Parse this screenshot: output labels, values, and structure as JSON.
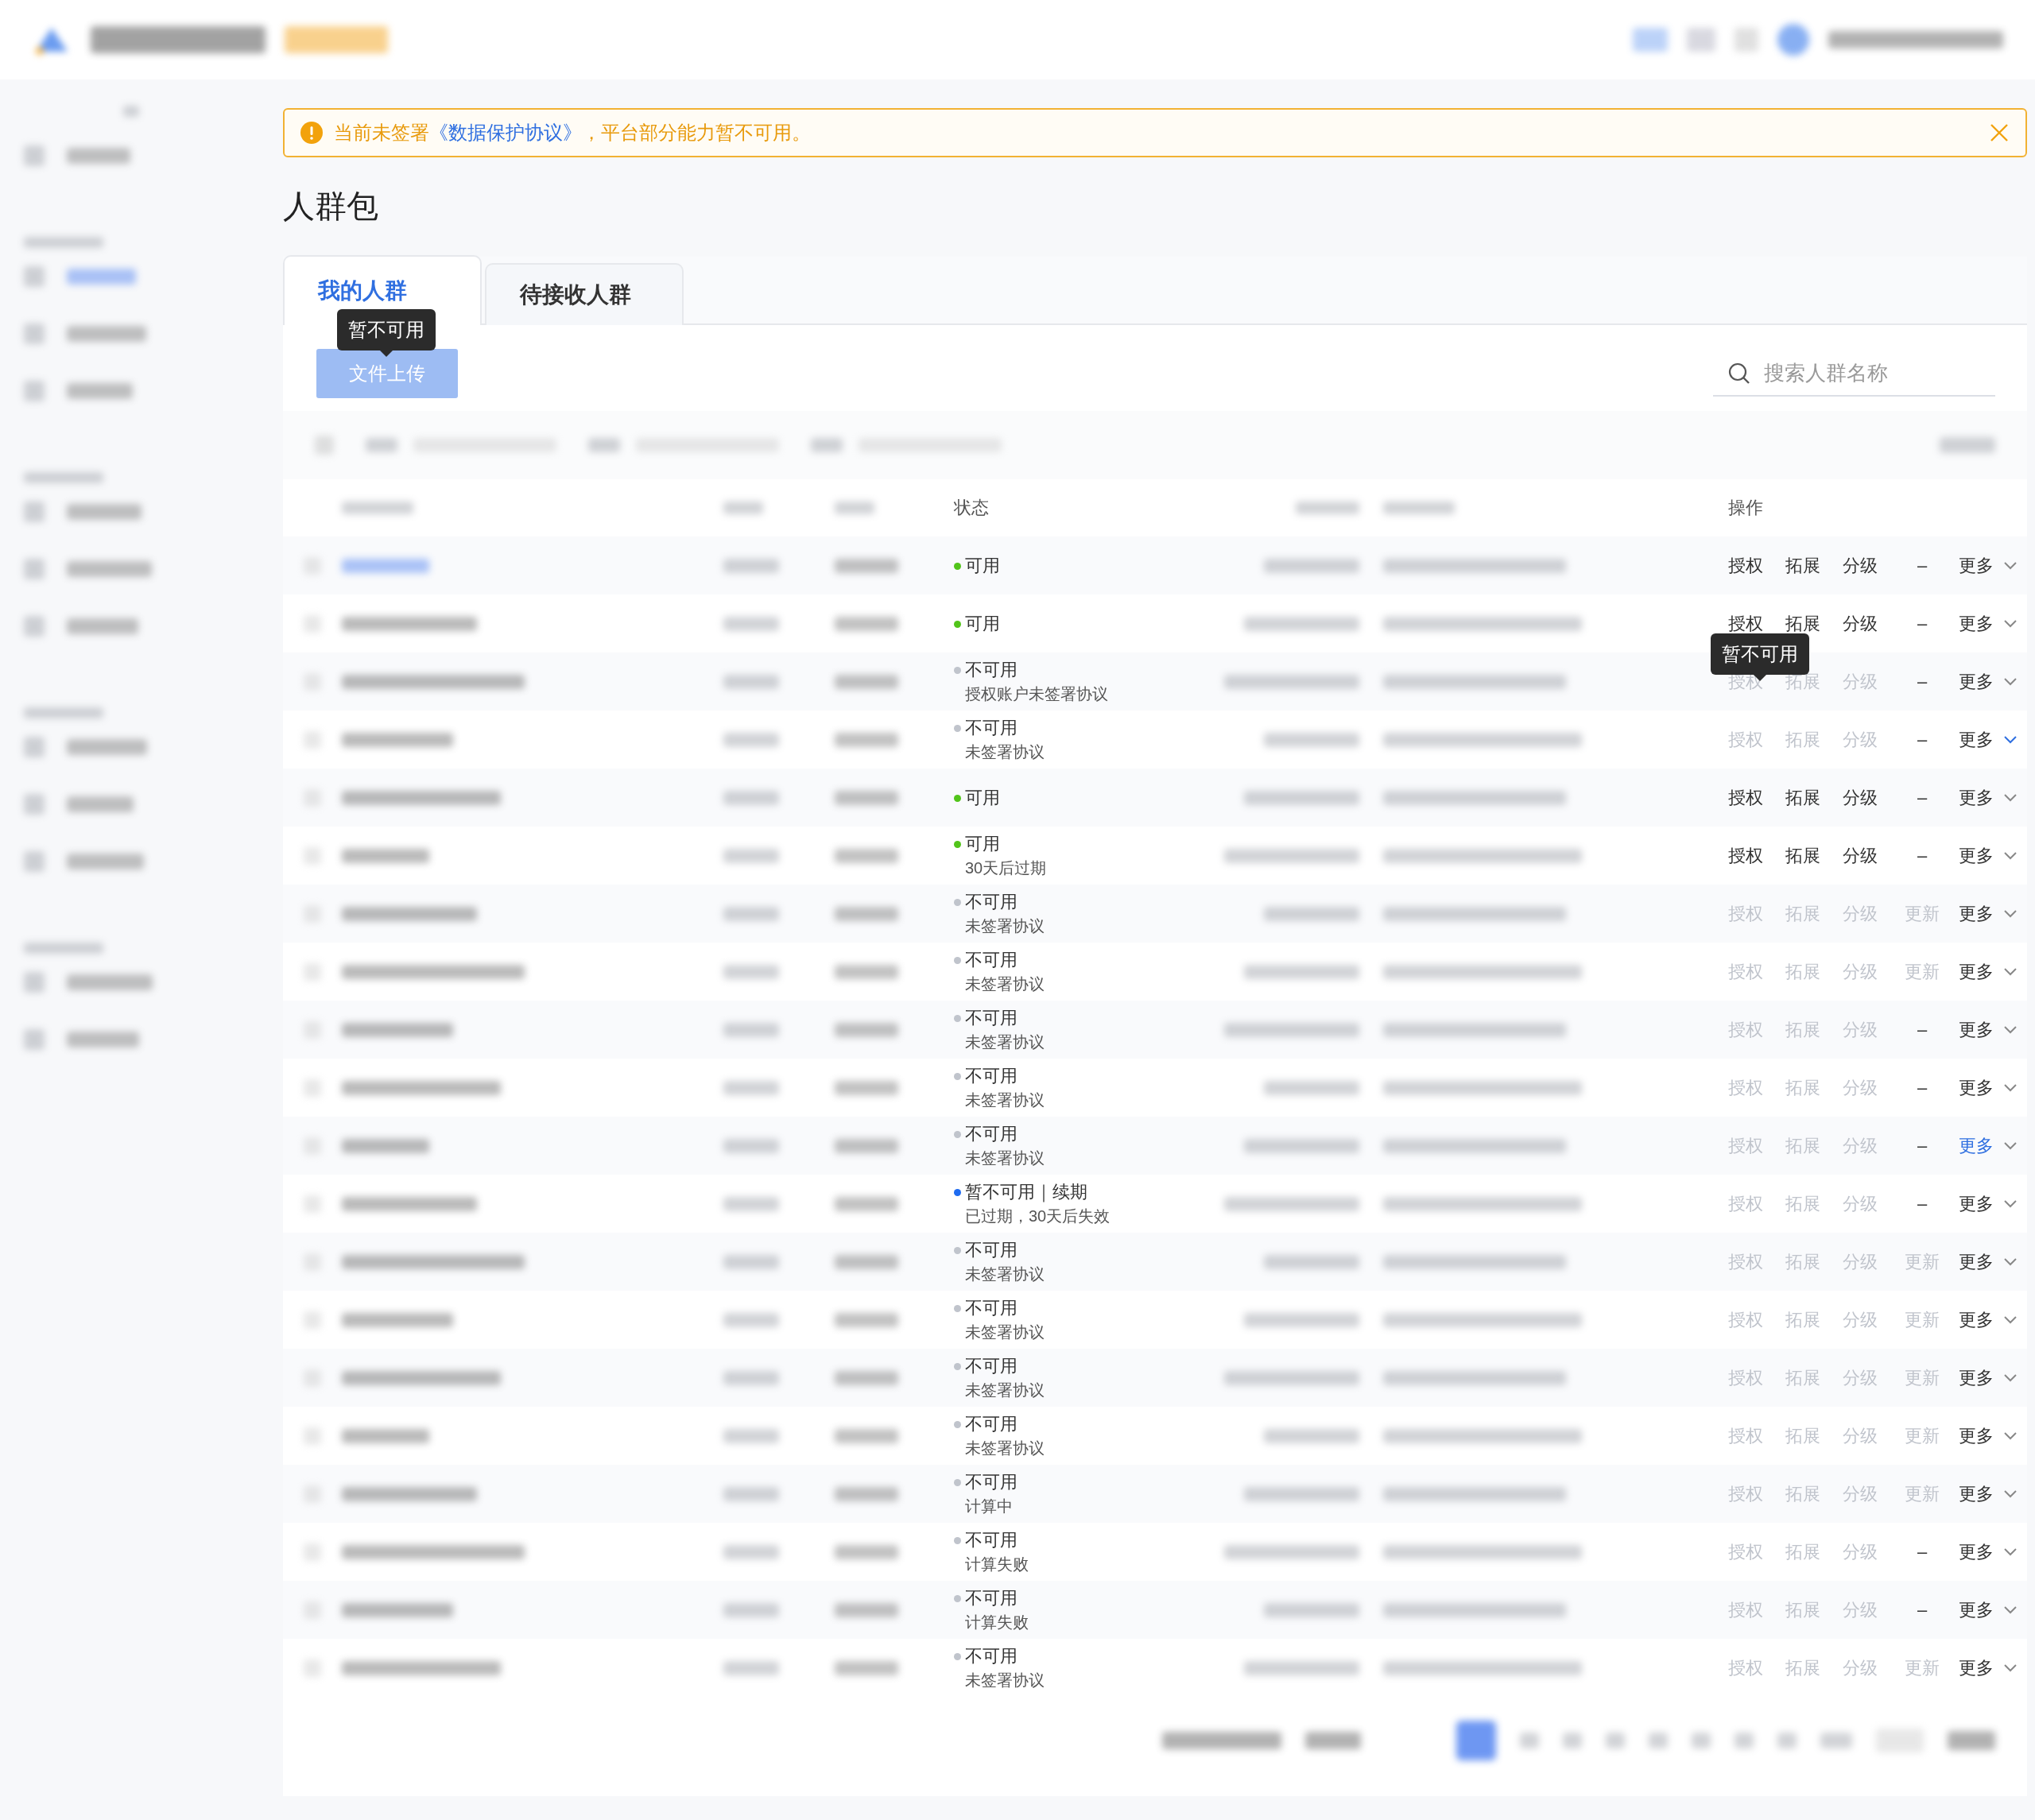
{
  "alert": {
    "text_before": "当前未签署",
    "link": "《数据保护协议》",
    "text_after": "，平台部分能力暂不可用。"
  },
  "page_title": "人群包",
  "tabs": [
    {
      "label": "我的人群",
      "selected": true
    },
    {
      "label": "待接收人群",
      "selected": false
    }
  ],
  "upload_button": {
    "label": "文件上传",
    "disabled": true,
    "tooltip": "暂不可用"
  },
  "search": {
    "placeholder": "搜索人群名称"
  },
  "table": {
    "columns": {
      "status": "状态",
      "actions": "操作"
    },
    "rows": [
      {
        "status": {
          "label": "可用",
          "color": "#52c41a"
        },
        "actions": [
          {
            "label": "授权",
            "disabled": false
          },
          {
            "label": "拓展",
            "disabled": false
          },
          {
            "label": "分级",
            "disabled": false
          },
          {
            "label": "–",
            "disabled": false
          }
        ],
        "more": {
          "label": "更多",
          "highlighted": false,
          "arrow_highlighted": false
        }
      },
      {
        "status": {
          "label": "可用",
          "color": "#52c41a"
        },
        "actions": [
          {
            "label": "授权",
            "disabled": false
          },
          {
            "label": "拓展",
            "disabled": false
          },
          {
            "label": "分级",
            "disabled": false
          },
          {
            "label": "–",
            "disabled": false
          }
        ],
        "more": {
          "label": "更多",
          "highlighted": false,
          "arrow_highlighted": false
        }
      },
      {
        "status": {
          "label": "不可用",
          "sub": "授权账户未签署协议",
          "color": "#c0c4cc"
        },
        "actions": [
          {
            "label": "授权",
            "disabled": true,
            "tooltip": "暂不可用"
          },
          {
            "label": "拓展",
            "disabled": true
          },
          {
            "label": "分级",
            "disabled": true
          },
          {
            "label": "–",
            "disabled": false
          }
        ],
        "more": {
          "label": "更多",
          "highlighted": false,
          "arrow_highlighted": false
        }
      },
      {
        "status": {
          "label": "不可用",
          "sub": "未签署协议",
          "color": "#c0c4cc"
        },
        "actions": [
          {
            "label": "授权",
            "disabled": true
          },
          {
            "label": "拓展",
            "disabled": true
          },
          {
            "label": "分级",
            "disabled": true
          },
          {
            "label": "–",
            "disabled": false
          }
        ],
        "more": {
          "label": "更多",
          "highlighted": false,
          "arrow_highlighted": true
        }
      },
      {
        "status": {
          "label": "可用",
          "color": "#52c41a"
        },
        "actions": [
          {
            "label": "授权",
            "disabled": false
          },
          {
            "label": "拓展",
            "disabled": false
          },
          {
            "label": "分级",
            "disabled": false
          },
          {
            "label": "–",
            "disabled": false
          }
        ],
        "more": {
          "label": "更多",
          "highlighted": false,
          "arrow_highlighted": false
        }
      },
      {
        "status": {
          "label": "可用",
          "sub": "30天后过期",
          "color": "#52c41a"
        },
        "actions": [
          {
            "label": "授权",
            "disabled": false
          },
          {
            "label": "拓展",
            "disabled": false
          },
          {
            "label": "分级",
            "disabled": false
          },
          {
            "label": "–",
            "disabled": false
          }
        ],
        "more": {
          "label": "更多",
          "highlighted": false,
          "arrow_highlighted": false
        }
      },
      {
        "status": {
          "label": "不可用",
          "sub": "未签署协议",
          "color": "#c0c4cc"
        },
        "actions": [
          {
            "label": "授权",
            "disabled": true
          },
          {
            "label": "拓展",
            "disabled": true
          },
          {
            "label": "分级",
            "disabled": true
          },
          {
            "label": "更新",
            "disabled": true
          }
        ],
        "more": {
          "label": "更多",
          "highlighted": false,
          "arrow_highlighted": false
        }
      },
      {
        "status": {
          "label": "不可用",
          "sub": "未签署协议",
          "color": "#c0c4cc"
        },
        "actions": [
          {
            "label": "授权",
            "disabled": true
          },
          {
            "label": "拓展",
            "disabled": true
          },
          {
            "label": "分级",
            "disabled": true
          },
          {
            "label": "更新",
            "disabled": true
          }
        ],
        "more": {
          "label": "更多",
          "highlighted": false,
          "arrow_highlighted": false
        }
      },
      {
        "status": {
          "label": "不可用",
          "sub": "未签署协议",
          "color": "#c0c4cc"
        },
        "actions": [
          {
            "label": "授权",
            "disabled": true
          },
          {
            "label": "拓展",
            "disabled": true
          },
          {
            "label": "分级",
            "disabled": true
          },
          {
            "label": "–",
            "disabled": false
          }
        ],
        "more": {
          "label": "更多",
          "highlighted": false,
          "arrow_highlighted": false
        }
      },
      {
        "status": {
          "label": "不可用",
          "sub": "未签署协议",
          "color": "#c0c4cc"
        },
        "actions": [
          {
            "label": "授权",
            "disabled": true
          },
          {
            "label": "拓展",
            "disabled": true
          },
          {
            "label": "分级",
            "disabled": true
          },
          {
            "label": "–",
            "disabled": false
          }
        ],
        "more": {
          "label": "更多",
          "highlighted": false,
          "arrow_highlighted": false
        }
      },
      {
        "status": {
          "label": "不可用",
          "sub": "未签署协议",
          "color": "#c0c4cc"
        },
        "actions": [
          {
            "label": "授权",
            "disabled": true
          },
          {
            "label": "拓展",
            "disabled": true
          },
          {
            "label": "分级",
            "disabled": true
          },
          {
            "label": "–",
            "disabled": false
          }
        ],
        "more": {
          "label": "更多",
          "highlighted": true,
          "arrow_highlighted": false
        }
      },
      {
        "status": {
          "label": "暂不可用｜续期",
          "sub": "已过期，30天后失效",
          "color": "#1f6bf0"
        },
        "actions": [
          {
            "label": "授权",
            "disabled": true
          },
          {
            "label": "拓展",
            "disabled": true
          },
          {
            "label": "分级",
            "disabled": true
          },
          {
            "label": "–",
            "disabled": false
          }
        ],
        "more": {
          "label": "更多",
          "highlighted": false,
          "arrow_highlighted": false
        }
      },
      {
        "status": {
          "label": "不可用",
          "sub": "未签署协议",
          "color": "#c0c4cc"
        },
        "actions": [
          {
            "label": "授权",
            "disabled": true
          },
          {
            "label": "拓展",
            "disabled": true
          },
          {
            "label": "分级",
            "disabled": true
          },
          {
            "label": "更新",
            "disabled": true
          }
        ],
        "more": {
          "label": "更多",
          "highlighted": false,
          "arrow_highlighted": false
        }
      },
      {
        "status": {
          "label": "不可用",
          "sub": "未签署协议",
          "color": "#c0c4cc"
        },
        "actions": [
          {
            "label": "授权",
            "disabled": true
          },
          {
            "label": "拓展",
            "disabled": true
          },
          {
            "label": "分级",
            "disabled": true
          },
          {
            "label": "更新",
            "disabled": true
          }
        ],
        "more": {
          "label": "更多",
          "highlighted": false,
          "arrow_highlighted": false
        }
      },
      {
        "status": {
          "label": "不可用",
          "sub": "未签署协议",
          "color": "#c0c4cc"
        },
        "actions": [
          {
            "label": "授权",
            "disabled": true
          },
          {
            "label": "拓展",
            "disabled": true
          },
          {
            "label": "分级",
            "disabled": true
          },
          {
            "label": "更新",
            "disabled": true
          }
        ],
        "more": {
          "label": "更多",
          "highlighted": false,
          "arrow_highlighted": false
        }
      },
      {
        "status": {
          "label": "不可用",
          "sub": "未签署协议",
          "color": "#c0c4cc"
        },
        "actions": [
          {
            "label": "授权",
            "disabled": true
          },
          {
            "label": "拓展",
            "disabled": true
          },
          {
            "label": "分级",
            "disabled": true
          },
          {
            "label": "更新",
            "disabled": true
          }
        ],
        "more": {
          "label": "更多",
          "highlighted": false,
          "arrow_highlighted": false
        }
      },
      {
        "status": {
          "label": "不可用",
          "sub": "计算中",
          "color": "#c0c4cc"
        },
        "actions": [
          {
            "label": "授权",
            "disabled": true
          },
          {
            "label": "拓展",
            "disabled": true
          },
          {
            "label": "分级",
            "disabled": true
          },
          {
            "label": "更新",
            "disabled": true
          }
        ],
        "more": {
          "label": "更多",
          "highlighted": false,
          "arrow_highlighted": false
        }
      },
      {
        "status": {
          "label": "不可用",
          "sub": "计算失败",
          "color": "#c0c4cc"
        },
        "actions": [
          {
            "label": "授权",
            "disabled": true
          },
          {
            "label": "拓展",
            "disabled": true
          },
          {
            "label": "分级",
            "disabled": true
          },
          {
            "label": "–",
            "disabled": false
          }
        ],
        "more": {
          "label": "更多",
          "highlighted": false,
          "arrow_highlighted": false
        }
      },
      {
        "status": {
          "label": "不可用",
          "sub": "计算失败",
          "color": "#c0c4cc"
        },
        "actions": [
          {
            "label": "授权",
            "disabled": true
          },
          {
            "label": "拓展",
            "disabled": true
          },
          {
            "label": "分级",
            "disabled": true
          },
          {
            "label": "–",
            "disabled": false
          }
        ],
        "more": {
          "label": "更多",
          "highlighted": false,
          "arrow_highlighted": false
        }
      },
      {
        "status": {
          "label": "不可用",
          "sub": "未签署协议",
          "color": "#c0c4cc"
        },
        "actions": [
          {
            "label": "授权",
            "disabled": true
          },
          {
            "label": "拓展",
            "disabled": true
          },
          {
            "label": "分级",
            "disabled": true
          },
          {
            "label": "更新",
            "disabled": true
          }
        ],
        "more": {
          "label": "更多",
          "highlighted": false,
          "arrow_highlighted": false
        }
      }
    ]
  }
}
